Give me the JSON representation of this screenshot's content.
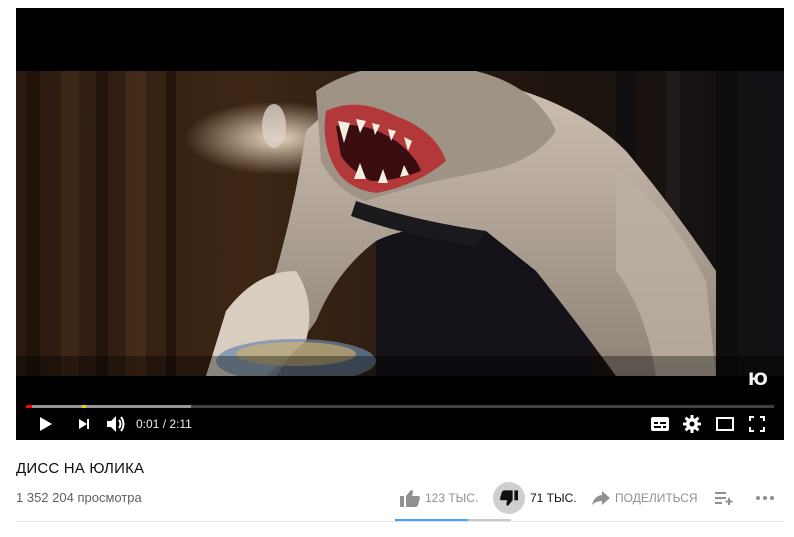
{
  "video": {
    "watermark": "Ю",
    "current_time": "0:01",
    "duration": "2:11",
    "played_fraction": 0.008,
    "buffered_fraction": 0.22,
    "progress_color": "#ff0000"
  },
  "controls": {
    "play_icon": "play-icon",
    "next_icon": "next-icon",
    "volume_icon": "volume-icon",
    "subtitles_icon": "subtitles-icon",
    "settings_icon": "gear-icon",
    "theater_icon": "theater-mode-icon",
    "fullscreen_icon": "fullscreen-icon"
  },
  "info": {
    "title": "ДИСС НА ЮЛИКА",
    "views": "1 352 204 просмотра"
  },
  "actions": {
    "like_count": "123 ТЫС.",
    "dislike_count": "71 ТЫС.",
    "share_label": "ПОДЕЛИТЬСЯ",
    "like_ratio": 0.63,
    "accent_color": "#3ea6ff"
  }
}
